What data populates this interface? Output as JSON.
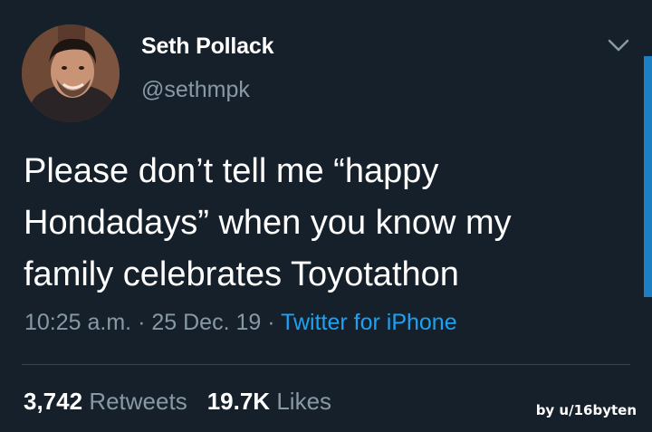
{
  "author": {
    "name": "Seth Pollack",
    "handle": "@sethmpk"
  },
  "tweet": {
    "lines": [
      "Please don’t tell me “happy",
      "Hondadays” when you know my",
      "family celebrates Toyotathon"
    ],
    "time": "10:25 a.m.",
    "separator": "·",
    "date": "25 Dec. 19",
    "source": "Twitter for iPhone"
  },
  "stats": {
    "retweets_count": "3,742",
    "retweets_label": "Retweets",
    "likes_count": "19.7K",
    "likes_label": "Likes"
  },
  "watermark": "by u/16byten",
  "icons": {
    "menu": "chevron-down-icon",
    "avatar": "profile-photo"
  },
  "colors": {
    "background": "#15202b",
    "primary_text": "#ffffff",
    "secondary_text": "#8899a6",
    "link": "#1da1f2",
    "divider": "#38444d"
  }
}
